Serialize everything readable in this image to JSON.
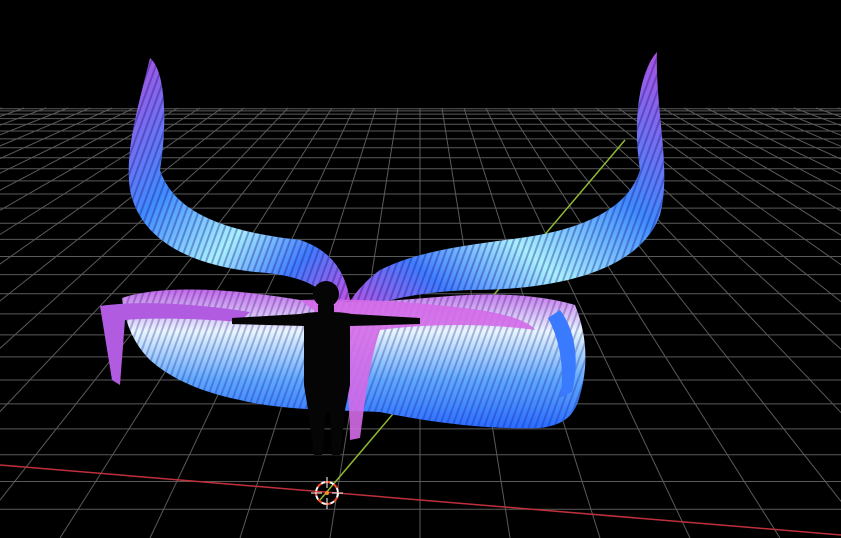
{
  "viewport": {
    "background": "#000000",
    "grid_color": "#5a5a5a",
    "x_axis_color": "#c0303a",
    "y_axis_color": "#8fb832",
    "cursor_color": "#ff8a2a"
  },
  "model": {
    "wing_colors": {
      "outer": "#2f3bd6",
      "mid": "#3f8bff",
      "light": "#a8f0ff",
      "accent": "#c94fe0"
    },
    "silhouette_color": "#050505"
  },
  "icons": {
    "cursor": "3d-cursor-icon"
  }
}
